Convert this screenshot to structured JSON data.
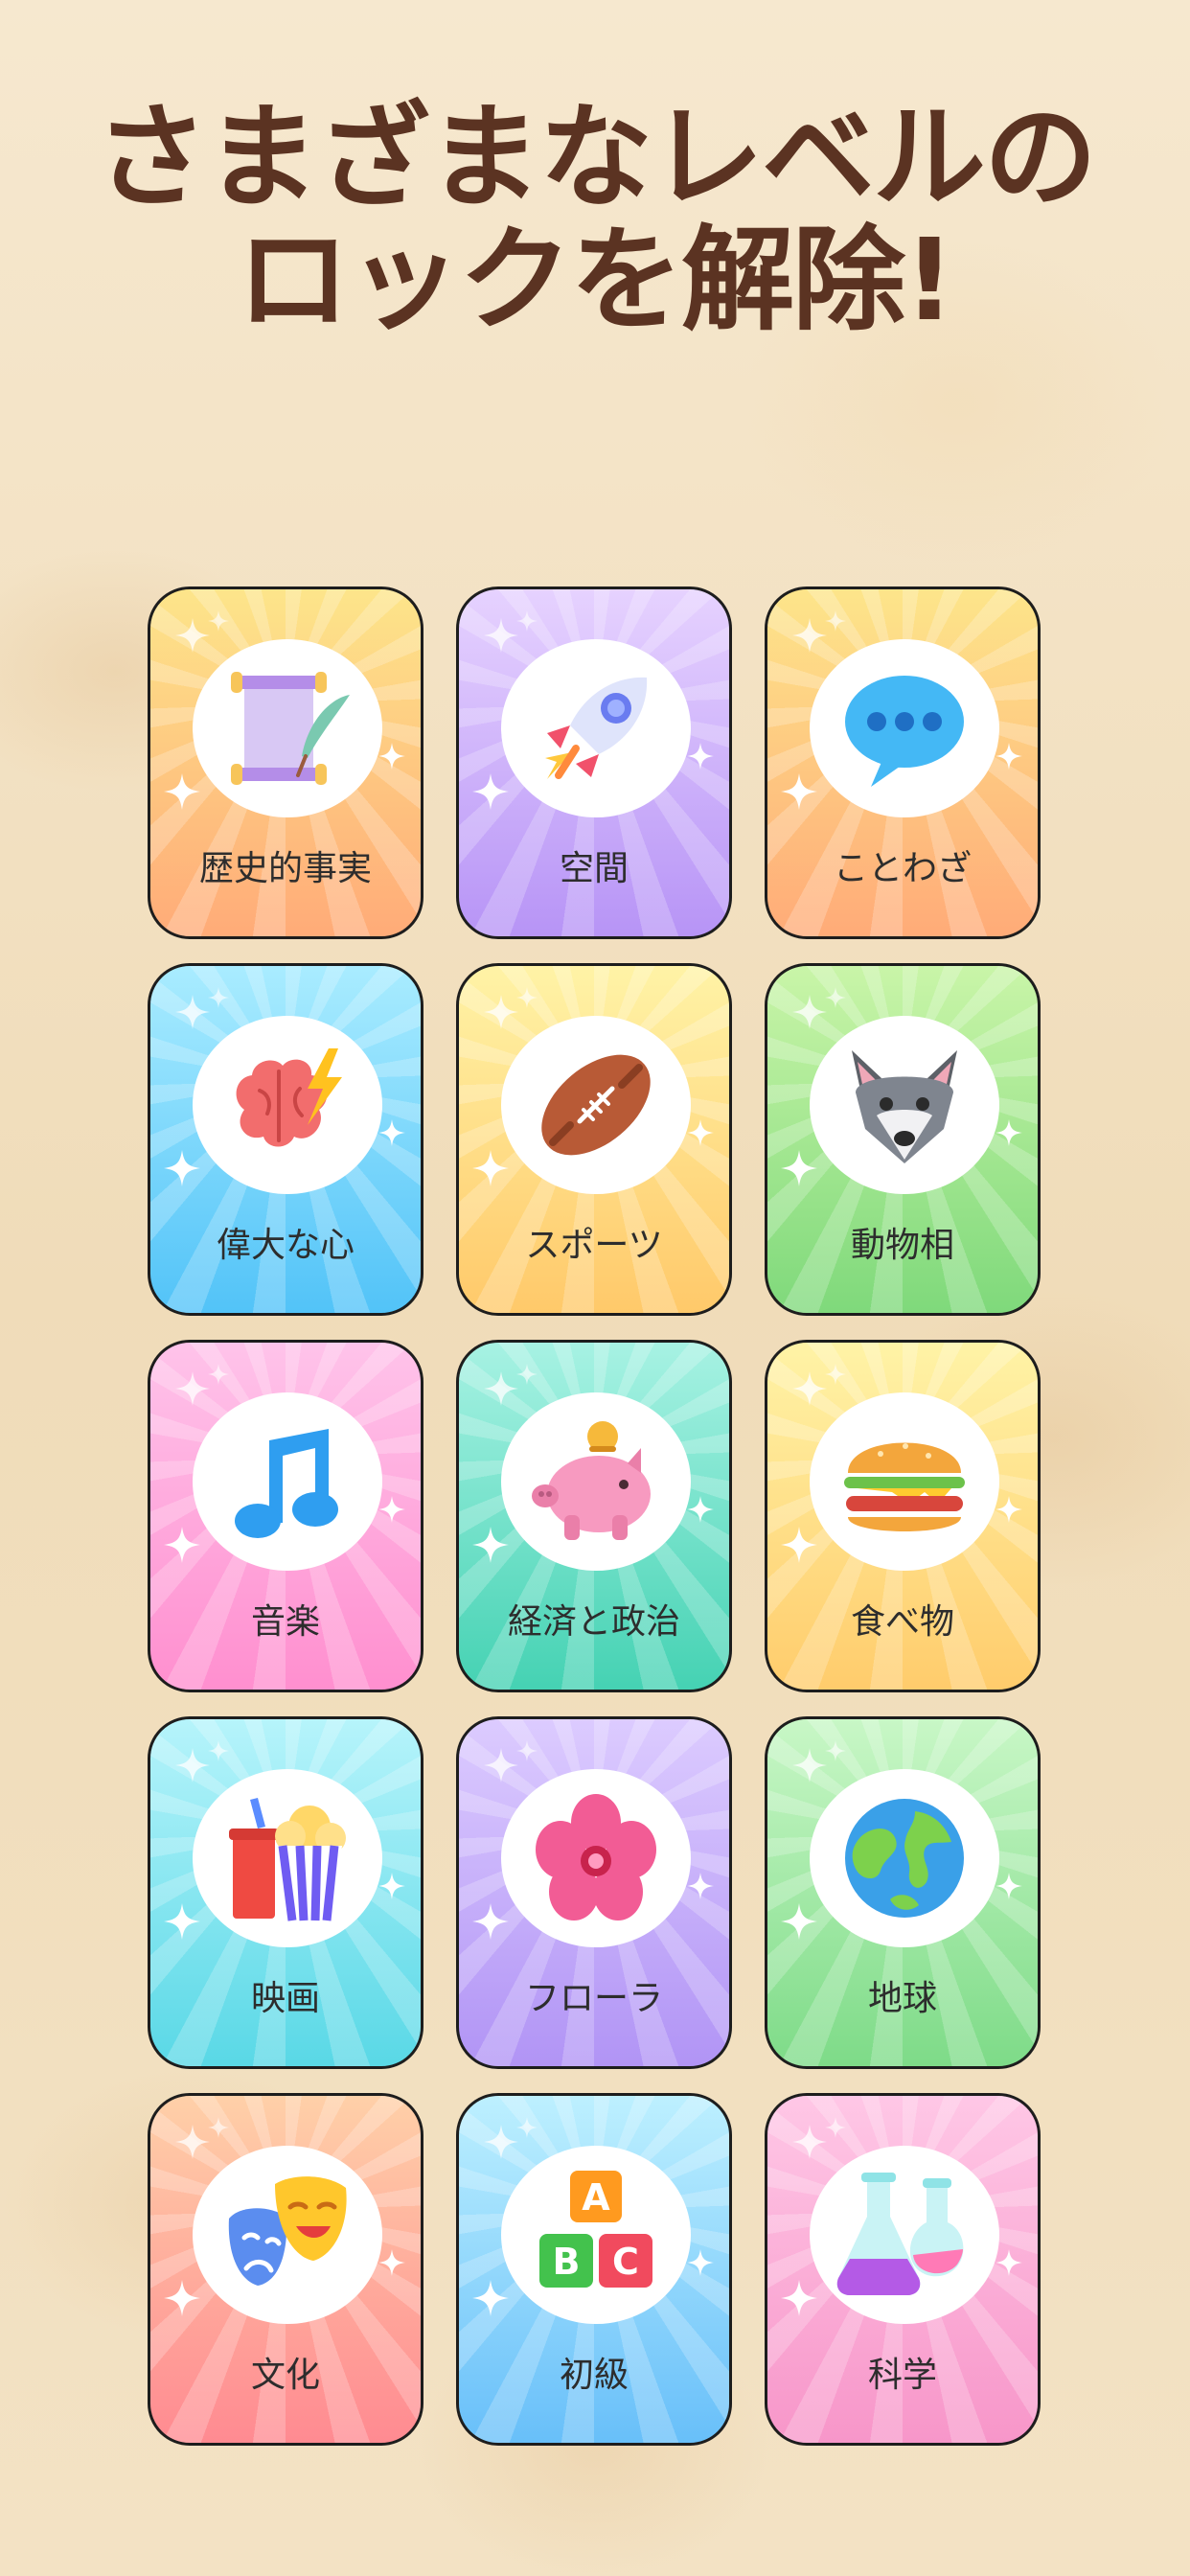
{
  "header": {
    "title_line1": "さまざまなレベルの",
    "title_line2": "ロックを解除!"
  },
  "colors": {
    "title": "#5b3322",
    "card_border": "#1d1d1d",
    "label_text": "#2d2d2d"
  },
  "categories": [
    {
      "label": "歴史的事実",
      "icon": "scroll-quill-icon",
      "gradient": [
        "#fde58a",
        "#ffab78"
      ]
    },
    {
      "label": "空間",
      "icon": "rocket-icon",
      "gradient": [
        "#e6d2ff",
        "#b794f6"
      ]
    },
    {
      "label": "ことわざ",
      "icon": "speech-bubble-icon",
      "gradient": [
        "#fde58a",
        "#ffab78"
      ]
    },
    {
      "label": "偉大な心",
      "icon": "brain-lightning-icon",
      "gradient": [
        "#a9ecff",
        "#52c3f8"
      ]
    },
    {
      "label": "スポーツ",
      "icon": "football-icon",
      "gradient": [
        "#fff3a6",
        "#ffc96a"
      ]
    },
    {
      "label": "動物相",
      "icon": "wolf-icon",
      "gradient": [
        "#c9f5a8",
        "#7fd97b"
      ]
    },
    {
      "label": "音楽",
      "icon": "music-note-icon",
      "gradient": [
        "#ffc3ea",
        "#ff8fcf"
      ]
    },
    {
      "label": "経済と政治",
      "icon": "piggy-bank-icon",
      "gradient": [
        "#a7f2e3",
        "#45d2b3"
      ]
    },
    {
      "label": "食べ物",
      "icon": "burger-icon",
      "gradient": [
        "#fff3a6",
        "#ffcc6c"
      ]
    },
    {
      "label": "映画",
      "icon": "popcorn-drink-icon",
      "gradient": [
        "#b6f4fb",
        "#59d8e6"
      ]
    },
    {
      "label": "フローラ",
      "icon": "flower-icon",
      "gradient": [
        "#dccbff",
        "#b194f5"
      ]
    },
    {
      "label": "地球",
      "icon": "globe-icon",
      "gradient": [
        "#c8f7c6",
        "#7edb88"
      ]
    },
    {
      "label": "文化",
      "icon": "theater-masks-icon",
      "gradient": [
        "#ffd0a8",
        "#ff8a91"
      ]
    },
    {
      "label": "初級",
      "icon": "abc-blocks-icon",
      "gradient": [
        "#bdf0ff",
        "#68bff9"
      ]
    },
    {
      "label": "科学",
      "icon": "flasks-icon",
      "gradient": [
        "#ffc7e6",
        "#f796c9"
      ]
    }
  ]
}
